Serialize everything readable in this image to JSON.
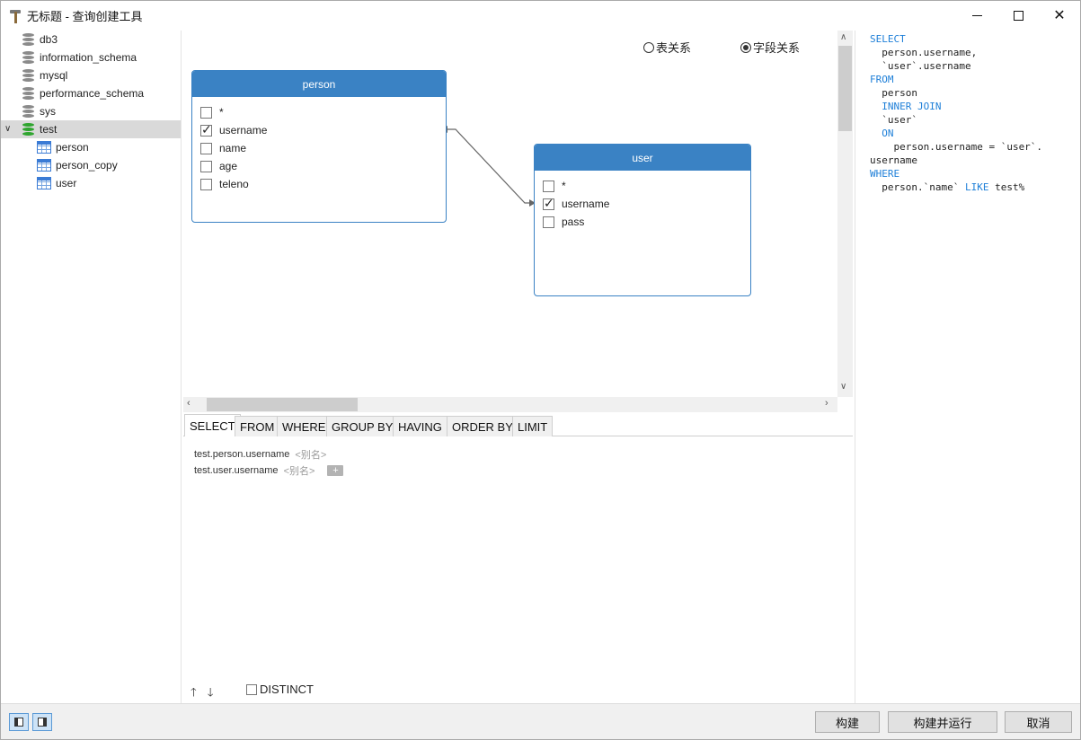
{
  "window": {
    "title": "无标题 - 查询创建工具",
    "controls": [
      "minimize-icon",
      "maximize-icon",
      "close-icon"
    ]
  },
  "tree": {
    "items": [
      {
        "label": "db3",
        "type": "database"
      },
      {
        "label": "information_schema",
        "type": "database"
      },
      {
        "label": "mysql",
        "type": "database"
      },
      {
        "label": "performance_schema",
        "type": "database"
      },
      {
        "label": "sys",
        "type": "database"
      },
      {
        "label": "test",
        "type": "database",
        "expanded": true,
        "selected": true
      },
      {
        "label": "person",
        "type": "table"
      },
      {
        "label": "person_copy",
        "type": "table"
      },
      {
        "label": "user",
        "type": "table"
      }
    ]
  },
  "canvas": {
    "relation_mode": {
      "options": [
        "表关系",
        "字段关系"
      ],
      "selected": "字段关系"
    },
    "tables": [
      {
        "name": "person",
        "fields": [
          {
            "name": "*",
            "checked": false
          },
          {
            "name": "username",
            "checked": true
          },
          {
            "name": "name",
            "checked": false
          },
          {
            "name": "age",
            "checked": false
          },
          {
            "name": "teleno",
            "checked": false
          }
        ]
      },
      {
        "name": "user",
        "fields": [
          {
            "name": "*",
            "checked": false
          },
          {
            "name": "username",
            "checked": true
          },
          {
            "name": "pass",
            "checked": false
          }
        ]
      }
    ]
  },
  "sql": {
    "lines": [
      [
        {
          "t": "SELECT",
          "kw": true
        }
      ],
      [
        {
          "t": "  person.username,",
          "kw": false
        }
      ],
      [
        {
          "t": "  `user`.username",
          "kw": false
        }
      ],
      [
        {
          "t": "FROM",
          "kw": true
        }
      ],
      [
        {
          "t": "  person",
          "kw": false
        }
      ],
      [
        {
          "t": "  ",
          "kw": false
        },
        {
          "t": "INNER JOIN",
          "kw": true
        }
      ],
      [
        {
          "t": "  `user`",
          "kw": false
        }
      ],
      [
        {
          "t": "  ",
          "kw": false
        },
        {
          "t": "ON",
          "kw": true
        }
      ],
      [
        {
          "t": "    person.username = `user`.",
          "kw": false
        }
      ],
      [
        {
          "t": "username",
          "kw": false
        }
      ],
      [
        {
          "t": "WHERE",
          "kw": true
        }
      ],
      [
        {
          "t": "  person.`name` ",
          "kw": false
        },
        {
          "t": "LIKE",
          "kw": true
        },
        {
          "t": " test%",
          "kw": false
        }
      ]
    ]
  },
  "clause_tabs": {
    "tabs": [
      "SELECT",
      "FROM",
      "WHERE",
      "GROUP BY",
      "HAVING",
      "ORDER BY",
      "LIMIT"
    ],
    "active": "SELECT"
  },
  "select_list": {
    "rows": [
      {
        "field": "test.person.username",
        "alias": "<别名>"
      },
      {
        "field": "test.user.username",
        "alias": "<别名>"
      }
    ],
    "add_label": "+",
    "distinct_label": "DISTINCT",
    "distinct_checked": false
  },
  "footer": {
    "build_label": "构建",
    "build_run_label": "构建并运行",
    "cancel_label": "取消"
  },
  "colors": {
    "table_header": "#3a82c4",
    "sql_keyword": "#1e7fd8",
    "selected_db": "#2fa52f"
  }
}
